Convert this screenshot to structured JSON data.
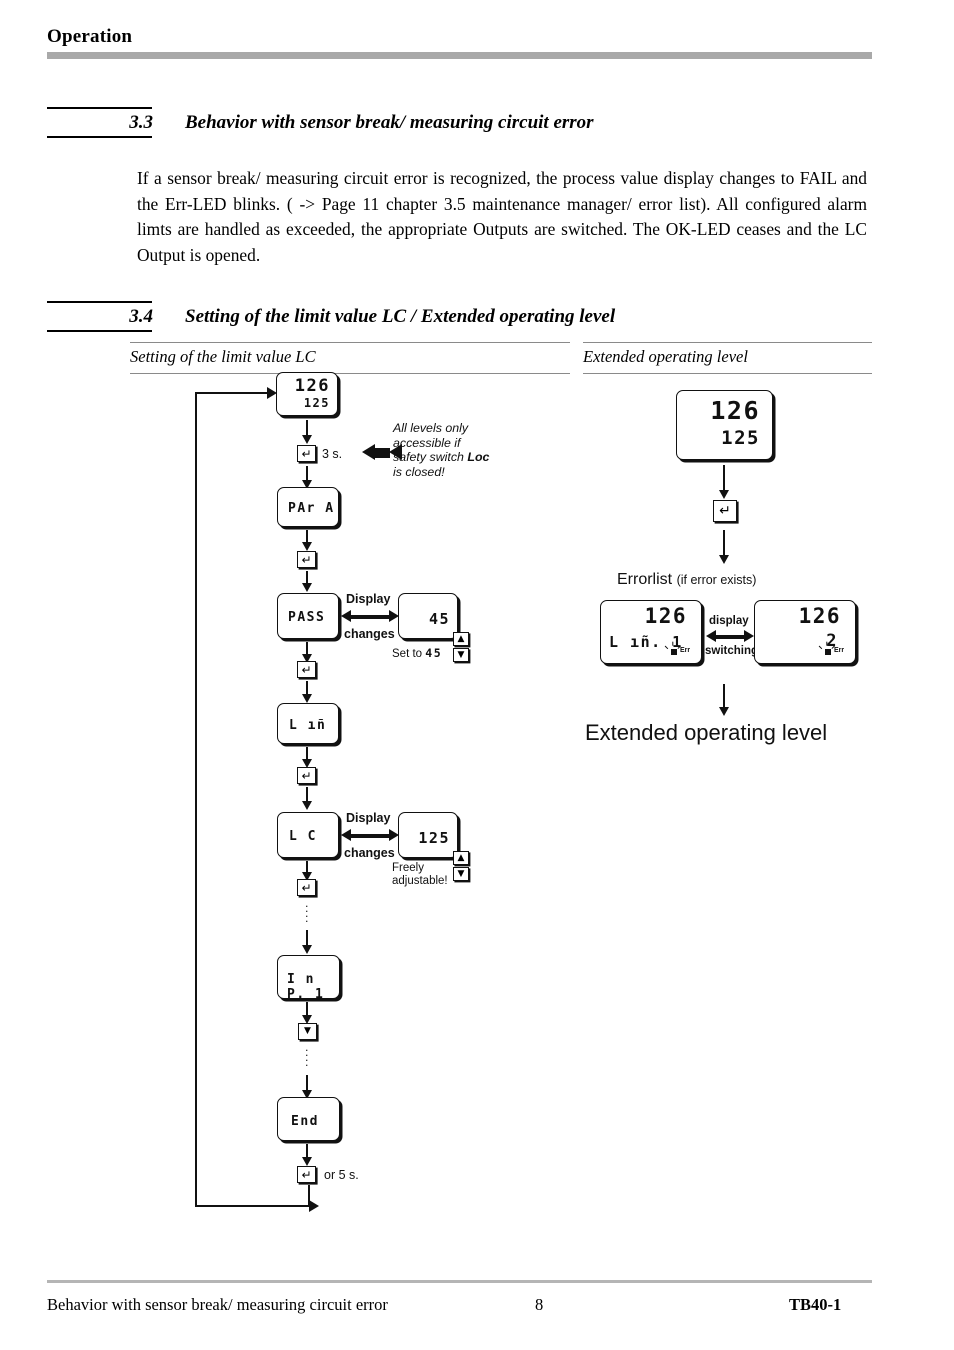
{
  "header": {
    "title": "Operation"
  },
  "sections": {
    "s33": {
      "number": "3.3",
      "title": "Behavior with sensor break/ measuring circuit error",
      "body": "If a sensor break/ measuring circuit error is recognized, the process value display changes to FAIL and the Err-LED blinks. ( -> Page 11 chapter 3.5 maintenance manager/ error list). All configured alarm limts are handled as exceeded, the appropriate Outputs are switched. The OK-LED ceases and the LC Output is opened."
    },
    "s34": {
      "number": "3.4",
      "title": "Setting of the limit value LC / Extended operating level"
    }
  },
  "columns": {
    "left_caption": "Setting of the limit value LC",
    "right_caption": "Extended operating level"
  },
  "left_flow": {
    "display_top": {
      "line1": "126",
      "line2": "125"
    },
    "key_enter": "↵",
    "key_down": "▼",
    "hold_3s": "3 s.",
    "safety_note_l1": "All levels only",
    "safety_note_l2": "accessible if",
    "safety_note_l3": "safety switch ",
    "safety_note_bold": "Loc",
    "safety_note_l4": "is closed!",
    "step_para": "PAr A",
    "step_pass": "PASS",
    "step_pass_value": "45",
    "step_pass_hint": "Set to",
    "step_pass_hint_value": "45",
    "step_lim": "L ıñ",
    "step_lc": "L C",
    "step_lc_value": "125",
    "step_lc_hint_l1": "Freely",
    "step_lc_hint_l2": "adjustable!",
    "step_inp1": "I n P. 1",
    "step_end": "End",
    "display_changes_l1": "Display",
    "display_changes_l2": "changes",
    "exit_label": "or 5 s.",
    "stepper_up": "▲",
    "stepper_down": "▼"
  },
  "right_flow": {
    "display_top": {
      "line1": "126",
      "line2": "125"
    },
    "key_enter": "↵",
    "errorlist_title": "Errorlist",
    "errorlist_sub": "(if error exists)",
    "error_box_left": {
      "line1": "126",
      "line2": "L ıñ. 1",
      "led": "Err"
    },
    "error_box_right": {
      "line1": "126",
      "line2": "2",
      "led": "Err"
    },
    "switch_l1": "display",
    "switch_l2": "switching",
    "result_caption": "Extended operating level"
  },
  "footer": {
    "left": "Behavior with sensor break/ measuring circuit error",
    "page": "8",
    "right": "TB40-1"
  }
}
